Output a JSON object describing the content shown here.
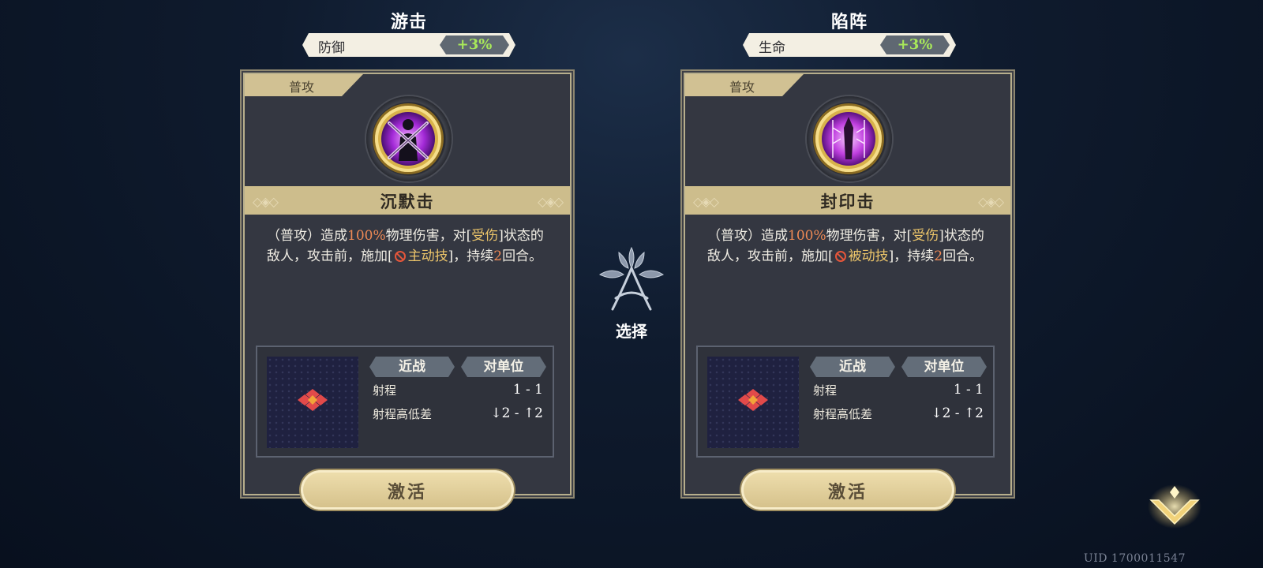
{
  "center": {
    "select_label": "选择"
  },
  "uid_text": "UID 1700011547",
  "cards": [
    {
      "class_title": "游击",
      "stat_label": "防御",
      "stat_value": "+3%",
      "tag": "普攻",
      "icon": "chained-silhouette-icon",
      "skill_name": "沉默击",
      "desc": {
        "p1": "（普攻）造成",
        "n1": "100%",
        "p2": "物理伤害，对[",
        "k1": "受伤",
        "p3": "]状态的敌人，攻击前，施加[",
        "k2": "主动技",
        "p4": "]，持续",
        "n2": "2",
        "p5": "回合。"
      },
      "pill1": "近战",
      "pill2": "对单位",
      "range_label": "射程",
      "range_value": "1 - 1",
      "height_label": "射程高低差",
      "height_value": "↓2 - ↑2",
      "button": "激活"
    },
    {
      "class_title": "陷阵",
      "stat_label": "生命",
      "stat_value": "+3%",
      "tag": "普攻",
      "icon": "sealed-obelisk-icon",
      "skill_name": "封印击",
      "desc": {
        "p1": "（普攻）造成",
        "n1": "100%",
        "p2": "物理伤害，对[",
        "k1": "受伤",
        "p3": "]状态的敌人，攻击前，施加[",
        "k2": "被动技",
        "p4": "]，持续",
        "n2": "2",
        "p5": "回合。"
      },
      "pill1": "近战",
      "pill2": "对单位",
      "range_label": "射程",
      "range_value": "1 - 1",
      "height_label": "射程高低差",
      "height_value": "↓2 - ↑2",
      "button": "激活"
    }
  ],
  "colors": {
    "positive": "#a8e85a",
    "number": "#ef8a55",
    "keyword": "#ecc56a",
    "accent_gold": "#cdbd8c"
  }
}
